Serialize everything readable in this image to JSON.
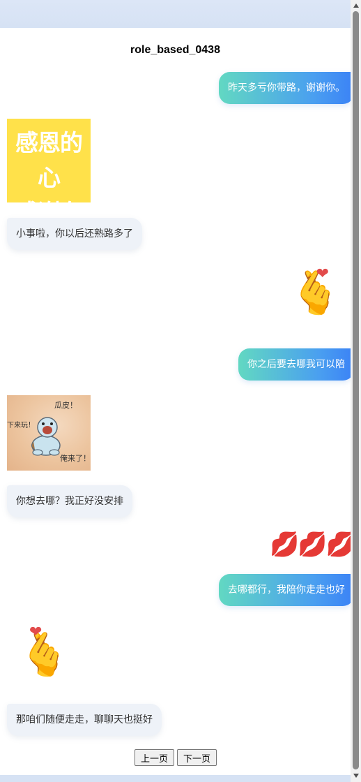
{
  "chat": {
    "title": "role_based_0438",
    "messages": [
      {
        "side": "right",
        "type": "text",
        "text": "昨天多亏你带路，谢谢你。"
      },
      {
        "side": "left",
        "type": "sticker",
        "sticker": "gratitude-text",
        "lines": [
          "感恩的心",
          "感谢有你"
        ]
      },
      {
        "side": "left",
        "type": "text",
        "text": "小事啦，你以后还熟路多了"
      },
      {
        "side": "right",
        "type": "sticker",
        "sticker": "finger-heart-emoji",
        "glyph": "🫰"
      },
      {
        "side": "right",
        "type": "text",
        "text": "你之后要去哪我可以陪"
      },
      {
        "side": "left",
        "type": "sticker",
        "sticker": "squirtle-meme",
        "captions": [
          "瓜皮！",
          "下来玩！",
          "俺来了！"
        ]
      },
      {
        "side": "left",
        "type": "text",
        "text": "你想去哪？我正好没安排"
      },
      {
        "side": "right",
        "type": "sticker",
        "sticker": "kiss-emojis",
        "glyph": "💋💋💋"
      },
      {
        "side": "right",
        "type": "text",
        "text": "去哪都行，我陪你走走也好"
      },
      {
        "side": "left",
        "type": "sticker",
        "sticker": "finger-heart-emoji",
        "glyph": "🫰"
      },
      {
        "side": "left",
        "type": "text",
        "text": "那咱们随便走走，聊聊天也挺好"
      }
    ]
  },
  "pagination": {
    "prev_label": "上一页",
    "next_label": "下一页"
  },
  "colors": {
    "bubble_gradient_start": "#62d8c2",
    "bubble_gradient_end": "#3b82f6",
    "left_bubble_bg": "#eef2f8",
    "sticker_yellow": "#ffe14a"
  }
}
